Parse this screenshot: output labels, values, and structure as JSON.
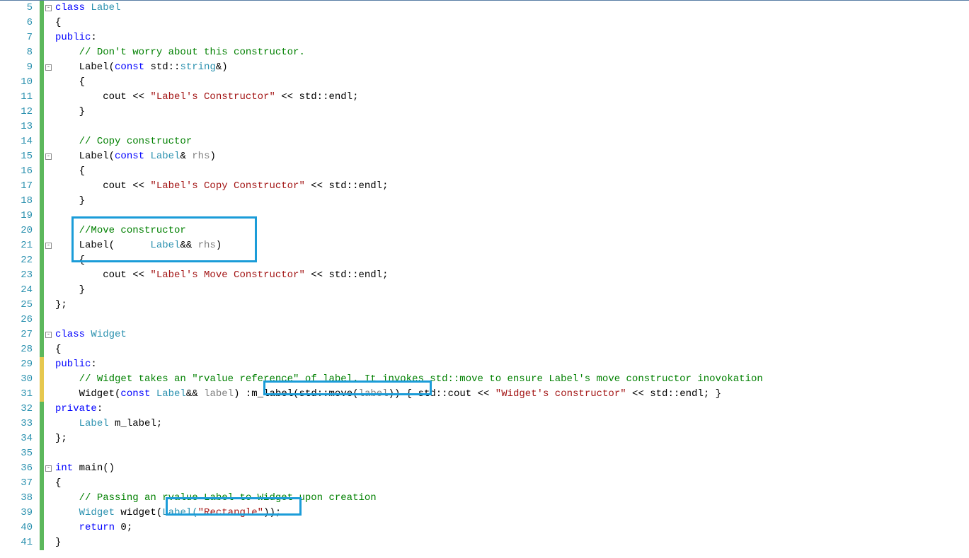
{
  "lineStart": 5,
  "lineEnd": 41,
  "yellowMarkerLines": [
    29,
    30,
    31
  ],
  "foldMarkers": [
    {
      "line": 5,
      "symbol": "-"
    },
    {
      "line": 9,
      "symbol": "-"
    },
    {
      "line": 15,
      "symbol": "-"
    },
    {
      "line": 21,
      "symbol": "-"
    },
    {
      "line": 27,
      "symbol": "-"
    },
    {
      "line": 36,
      "symbol": "-"
    }
  ],
  "code": {
    "l5": {
      "t0": "class ",
      "t1": "Label"
    },
    "l6": {
      "t0": "{"
    },
    "l7": {
      "t0": "public",
      "t1": ":"
    },
    "l8": {
      "t0": "    ",
      "t1": "// Don't worry about this constructor."
    },
    "l9": {
      "t0": "    Label(",
      "t1": "const ",
      "t2": "std::",
      "t3": "string",
      "t4": "&)"
    },
    "l10": {
      "t0": "    {"
    },
    "l11": {
      "t0": "        cout << ",
      "t1": "\"Label's Constructor\"",
      "t2": " << std::endl;"
    },
    "l12": {
      "t0": "    }"
    },
    "l13": {
      "t0": ""
    },
    "l14": {
      "t0": "    ",
      "t1": "// Copy constructor"
    },
    "l15": {
      "t0": "    Label(",
      "t1": "const ",
      "t2": "Label",
      "t3": "& ",
      "t4": "rhs",
      "t5": ")"
    },
    "l16": {
      "t0": "    {"
    },
    "l17": {
      "t0": "        cout << ",
      "t1": "\"Label's Copy Constructor\"",
      "t2": " << std::endl;"
    },
    "l18": {
      "t0": "    }"
    },
    "l19": {
      "t0": ""
    },
    "l20": {
      "t0": "    ",
      "t1": "//Move constructor"
    },
    "l21": {
      "t0": "    Label(      ",
      "t1": "Label",
      "t2": "&& ",
      "t3": "rhs",
      "t4": ")"
    },
    "l22": {
      "t0": "    {"
    },
    "l23": {
      "t0": "        cout << ",
      "t1": "\"Label's Move Constructor\"",
      "t2": " << std::endl;"
    },
    "l24": {
      "t0": "    }"
    },
    "l25": {
      "t0": "};"
    },
    "l26": {
      "t0": ""
    },
    "l27": {
      "t0": "class ",
      "t1": "Widget"
    },
    "l28": {
      "t0": "{"
    },
    "l29": {
      "t0": "public",
      "t1": ":"
    },
    "l30": {
      "t0": "    ",
      "t1": "// Widget takes an \"rvalue reference\" of label. It invokes std::move to ensure Label's move constructor inovokation"
    },
    "l31": {
      "t0": "    Widget(",
      "t1": "const ",
      "t2": "Label",
      "t3": "&& ",
      "t4": "label",
      "t5": ") ",
      "t6": ":m_label(std::move(",
      "t7": "label",
      "t8": "))",
      "t9": " { std::cout << ",
      "t10": "\"Widget's constructor\"",
      "t11": " << std::endl; }"
    },
    "l32": {
      "t0": "private",
      "t1": ":"
    },
    "l33": {
      "t0": "    ",
      "t1": "Label ",
      "t2": "m_label;"
    },
    "l34": {
      "t0": "};"
    },
    "l35": {
      "t0": ""
    },
    "l36": {
      "t0": "int ",
      "t1": "main()"
    },
    "l37": {
      "t0": "{"
    },
    "l38": {
      "t0": "    ",
      "t1": "// Passing an rvalue Label to Widget upon creation"
    },
    "l39": {
      "t0": "    ",
      "t1": "Widget ",
      "t2": "widget(",
      "t3": "Label(",
      "t4": "\"Rectangle\"",
      "t5": "));"
    },
    "l40": {
      "t0": "    ",
      "t1": "return ",
      "t2": "0;"
    },
    "l41": {
      "t0": "}"
    }
  },
  "highlights": [
    {
      "topLine": 19.5,
      "leftCh": 3,
      "heightLines": 3.1,
      "widthCh": 31
    },
    {
      "topLine": 30.55,
      "leftCh": 35,
      "heightLines": 1.0,
      "widthCh": 28.2
    },
    {
      "topLine": 38.45,
      "leftCh": 18.7,
      "heightLines": 1.2,
      "widthCh": 22.7
    }
  ],
  "colors": {
    "accent": "#1b9cd8",
    "changeMarker": "#5cb85c",
    "unsavedMarker": "#e6c84f"
  }
}
